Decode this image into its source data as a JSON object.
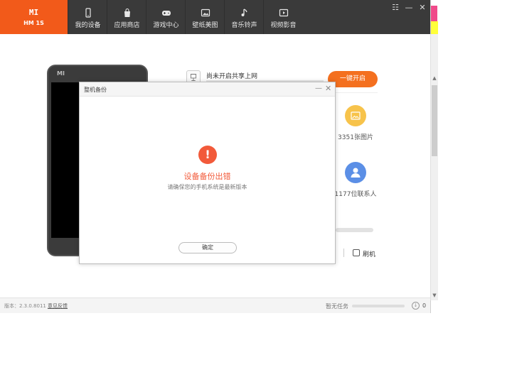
{
  "brand": {
    "logo": "MI",
    "model": "HM 1S",
    "color": "#f25a1a"
  },
  "nav": [
    {
      "label": "我的设备",
      "icon": "phone-icon"
    },
    {
      "label": "应用商店",
      "icon": "bag-icon"
    },
    {
      "label": "游戏中心",
      "icon": "gamepad-icon"
    },
    {
      "label": "壁纸美图",
      "icon": "picture-icon"
    },
    {
      "label": "音乐铃声",
      "icon": "music-note-icon"
    },
    {
      "label": "视频影音",
      "icon": "video-play-icon"
    }
  ],
  "window_controls": {
    "menu": "☷",
    "minimize": "—",
    "close": "✕"
  },
  "phone": {
    "logo": "MI"
  },
  "share_wifi": {
    "title": "尚未开启共享上网",
    "button": "一键开启"
  },
  "stats": {
    "photos": "3351张图片",
    "contacts": "1177位联系人"
  },
  "flash": {
    "label": "刷机"
  },
  "statusbar": {
    "version": "版本：2.3.0.8011",
    "feedback": "意见反馈",
    "task_status": "暂无任务",
    "download_count": "0"
  },
  "dialog": {
    "title": "整机备份",
    "error_title": "设备备份出错",
    "error_desc": "请确保您的手机系统是最新版本",
    "ok_button": "确定",
    "error_color": "#f25a3a"
  },
  "colors": {
    "accent": "#f4701f",
    "photo": "#f7c34b",
    "contact": "#5b8fe6"
  }
}
